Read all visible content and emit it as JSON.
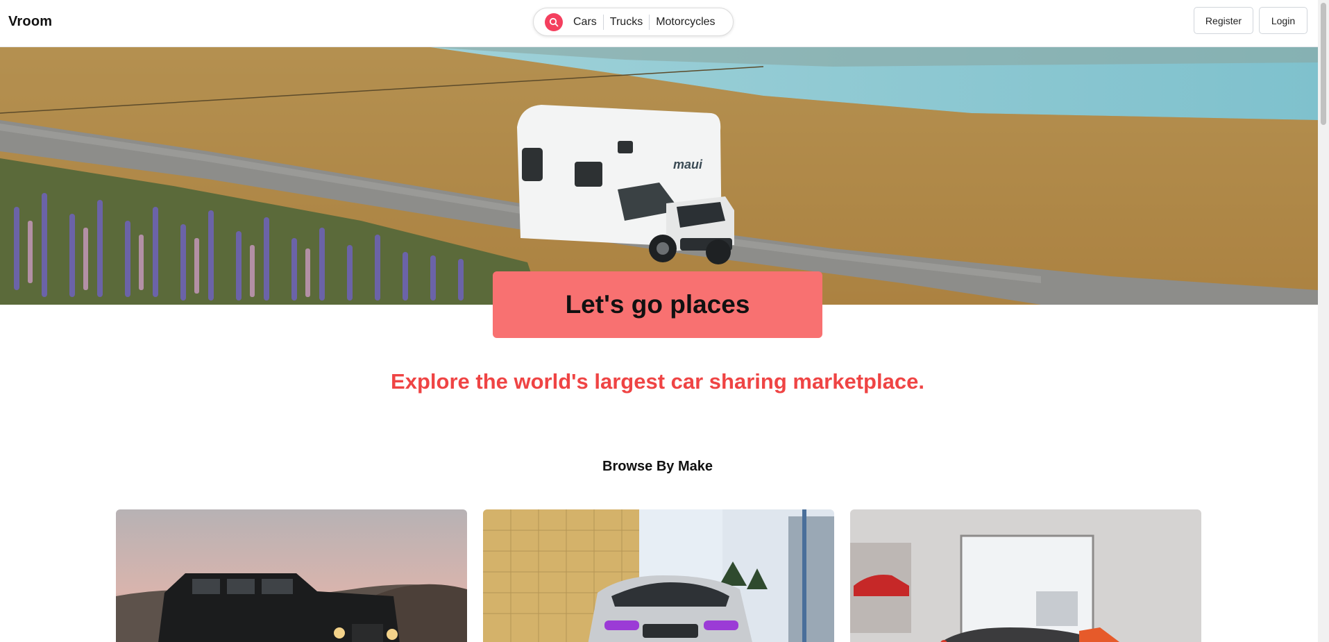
{
  "header": {
    "logo": "Vroom",
    "search": {
      "categories": [
        "Cars",
        "Trucks",
        "Motorcycles"
      ]
    },
    "register_label": "Register",
    "login_label": "Login"
  },
  "hero": {
    "image_label": "maui",
    "cta_label": "Let's go places"
  },
  "tagline": "Explore the world's largest car sharing marketplace.",
  "browse": {
    "title": "Browse By Make"
  },
  "colors": {
    "accent": "#f43f5e",
    "cta_bg": "#f87171",
    "tagline": "#ef4444"
  },
  "icons": [
    "search-icon"
  ]
}
